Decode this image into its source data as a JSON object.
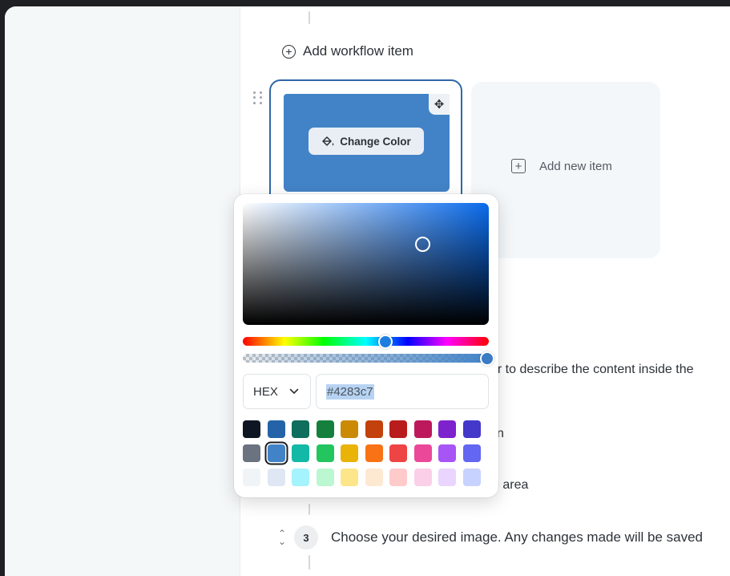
{
  "workflow": {
    "add_item_label": "Add workflow item",
    "add_new_item_label": "Add new item",
    "change_color_label": "Change Color",
    "card_color": "#4283c7"
  },
  "background_text": {
    "line1": "er to describe the content inside the",
    "line2": "n",
    "line3": "e area"
  },
  "step": {
    "number": "3",
    "text": "Choose your desired image. Any changes made will be saved"
  },
  "picker": {
    "format": "HEX",
    "hex_value": "#4283c7",
    "hue_color": "#0a6bec",
    "swatches": [
      "#0f1623",
      "#2563a8",
      "#0f6e5e",
      "#15803d",
      "#ca8a04",
      "#c2410c",
      "#b91c1c",
      "#be185d",
      "#7e22ce",
      "#4338ca",
      "#6b7280",
      "#4283c7",
      "#14b8a6",
      "#22c55e",
      "#eab308",
      "#f97316",
      "#ef4444",
      "#ec4899",
      "#a855f7",
      "#6366f1",
      "#f1f4f7",
      "#dfe6f4",
      "#a5f3fc",
      "#bbf7d0",
      "#fde68a",
      "#fde9d2",
      "#fecaca",
      "#fbcfe8",
      "#e9d5ff",
      "#c7d2fe"
    ],
    "selected_swatch_index": 11
  }
}
